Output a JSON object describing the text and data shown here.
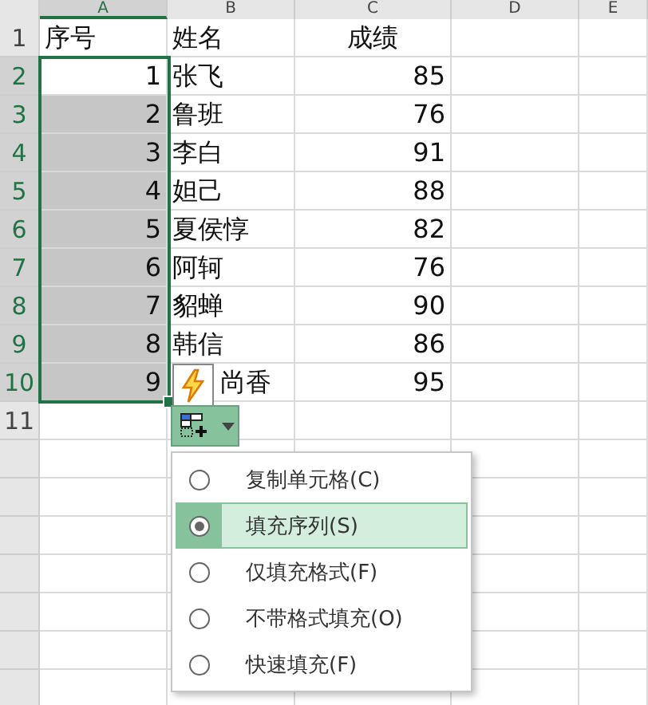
{
  "columns": [
    {
      "label": "A",
      "selected": true
    },
    {
      "label": "B",
      "selected": false
    },
    {
      "label": "C",
      "selected": false
    },
    {
      "label": "D",
      "selected": false
    },
    {
      "label": "E",
      "selected": false
    }
  ],
  "rows": [
    {
      "number": "1",
      "kind": "header",
      "selected": false,
      "cells": [
        "序号",
        "姓名",
        "成绩"
      ],
      "highlighted": false
    },
    {
      "number": "2",
      "kind": "data",
      "selected": true,
      "cells": [
        "1",
        "张飞",
        "85"
      ],
      "highlighted": false
    },
    {
      "number": "3",
      "kind": "data",
      "selected": true,
      "cells": [
        "2",
        "鲁班",
        "76"
      ],
      "highlighted": true
    },
    {
      "number": "4",
      "kind": "data",
      "selected": true,
      "cells": [
        "3",
        "李白",
        "91"
      ],
      "highlighted": true
    },
    {
      "number": "5",
      "kind": "data",
      "selected": true,
      "cells": [
        "4",
        "妲己",
        "88"
      ],
      "highlighted": true
    },
    {
      "number": "6",
      "kind": "data",
      "selected": true,
      "cells": [
        "5",
        "夏侯惇",
        "82"
      ],
      "highlighted": true
    },
    {
      "number": "7",
      "kind": "data",
      "selected": true,
      "cells": [
        "6",
        "阿轲",
        "76"
      ],
      "highlighted": true
    },
    {
      "number": "8",
      "kind": "data",
      "selected": true,
      "cells": [
        "7",
        "貂蝉",
        "90"
      ],
      "highlighted": true
    },
    {
      "number": "9",
      "kind": "data",
      "selected": true,
      "cells": [
        "8",
        "韩信",
        "86"
      ],
      "highlighted": true
    },
    {
      "number": "10",
      "kind": "data",
      "selected": true,
      "cells": [
        "9",
        "尚香",
        "95"
      ],
      "highlighted": true
    },
    {
      "number": "11",
      "selected": false,
      "highlighted": false
    }
  ],
  "fill_menu": [
    {
      "label": "复制单元格(C)",
      "selected": false
    },
    {
      "label": "填充序列(S)",
      "selected": true
    },
    {
      "label": "仅填充格式(F)",
      "selected": false
    },
    {
      "label": "不带格式填充(O)",
      "selected": false
    },
    {
      "label": "快速填充(F)",
      "selected": false
    }
  ]
}
